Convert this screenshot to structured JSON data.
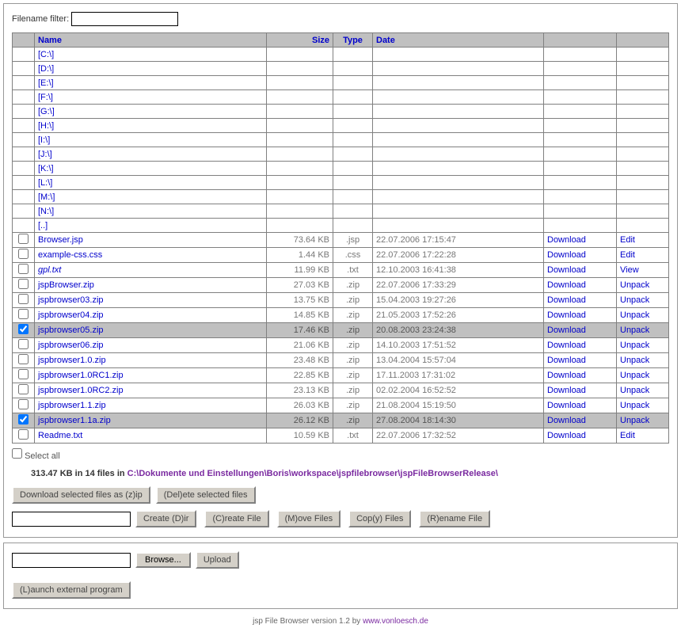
{
  "filter": {
    "label": "Filename filter:",
    "value": ""
  },
  "headers": {
    "name": "Name",
    "size": "Size",
    "type": "Type",
    "date": "Date"
  },
  "drives": [
    "[C:\\]",
    "[D:\\]",
    "[E:\\]",
    "[F:\\]",
    "[G:\\]",
    "[H:\\]",
    "[I:\\]",
    "[J:\\]",
    "[K:\\]",
    "[L:\\]",
    "[M:\\]",
    "[N:\\]",
    "[..]"
  ],
  "files": [
    {
      "chk": false,
      "name": "Browser.jsp",
      "ital": false,
      "size": "73.64 KB",
      "type": ".jsp",
      "date": "22.07.2006 17:15:47",
      "act1": "Download",
      "act2": "Edit"
    },
    {
      "chk": false,
      "name": "example-css.css",
      "ital": false,
      "size": "1.44 KB",
      "type": ".css",
      "date": "22.07.2006 17:22:28",
      "act1": "Download",
      "act2": "Edit"
    },
    {
      "chk": false,
      "name": "gpl.txt",
      "ital": true,
      "size": "11.99 KB",
      "type": ".txt",
      "date": "12.10.2003 16:41:38",
      "act1": "Download",
      "act2": "View"
    },
    {
      "chk": false,
      "name": "jspBrowser.zip",
      "ital": false,
      "size": "27.03 KB",
      "type": ".zip",
      "date": "22.07.2006 17:33:29",
      "act1": "Download",
      "act2": "Unpack"
    },
    {
      "chk": false,
      "name": "jspbrowser03.zip",
      "ital": false,
      "size": "13.75 KB",
      "type": ".zip",
      "date": "15.04.2003 19:27:26",
      "act1": "Download",
      "act2": "Unpack"
    },
    {
      "chk": false,
      "name": "jspbrowser04.zip",
      "ital": false,
      "size": "14.85 KB",
      "type": ".zip",
      "date": "21.05.2003 17:52:26",
      "act1": "Download",
      "act2": "Unpack"
    },
    {
      "chk": true,
      "name": "jspbrowser05.zip",
      "ital": false,
      "size": "17.46 KB",
      "type": ".zip",
      "date": "20.08.2003 23:24:38",
      "act1": "Download",
      "act2": "Unpack"
    },
    {
      "chk": false,
      "name": "jspbrowser06.zip",
      "ital": false,
      "size": "21.06 KB",
      "type": ".zip",
      "date": "14.10.2003 17:51:52",
      "act1": "Download",
      "act2": "Unpack"
    },
    {
      "chk": false,
      "name": "jspbrowser1.0.zip",
      "ital": false,
      "size": "23.48 KB",
      "type": ".zip",
      "date": "13.04.2004 15:57:04",
      "act1": "Download",
      "act2": "Unpack"
    },
    {
      "chk": false,
      "name": "jspbrowser1.0RC1.zip",
      "ital": false,
      "size": "22.85 KB",
      "type": ".zip",
      "date": "17.11.2003 17:31:02",
      "act1": "Download",
      "act2": "Unpack"
    },
    {
      "chk": false,
      "name": "jspbrowser1.0RC2.zip",
      "ital": false,
      "size": "23.13 KB",
      "type": ".zip",
      "date": "02.02.2004 16:52:52",
      "act1": "Download",
      "act2": "Unpack"
    },
    {
      "chk": false,
      "name": "jspbrowser1.1.zip",
      "ital": false,
      "size": "26.03 KB",
      "type": ".zip",
      "date": "21.08.2004 15:19:50",
      "act1": "Download",
      "act2": "Unpack"
    },
    {
      "chk": true,
      "name": "jspbrowser1.1a.zip",
      "ital": false,
      "size": "26.12 KB",
      "type": ".zip",
      "date": "27.08.2004 18:14:30",
      "act1": "Download",
      "act2": "Unpack"
    },
    {
      "chk": false,
      "name": "Readme.txt",
      "ital": false,
      "size": "10.59 KB",
      "type": ".txt",
      "date": "22.07.2006 17:32:52",
      "act1": "Download",
      "act2": "Edit"
    }
  ],
  "selectall": {
    "label": "Select all",
    "checked": false
  },
  "summary": {
    "prefix": "313.47 KB in 14 files in ",
    "path": "C:\\Dokumente und Einstellungen\\Boris\\workspace\\jspfilebrowser\\jspFileBrowserRelease\\"
  },
  "buttons": {
    "downloadZip": "Download selected files as (z)ip",
    "deleteSel": "(Del)ete selected files",
    "createDir": "Create (D)ir",
    "createFile": "(C)reate File",
    "moveFiles": "(M)ove Files",
    "copyFiles": "Cop(y) Files",
    "renameFile": "(R)ename File",
    "browse": "Browse...",
    "upload": "Upload",
    "launch": "(L)aunch external program"
  },
  "inputs": {
    "newname": "",
    "uploadpath": ""
  },
  "footer": {
    "prefix": "jsp File Browser version 1.2 by ",
    "link": "www.vonloesch.de"
  }
}
